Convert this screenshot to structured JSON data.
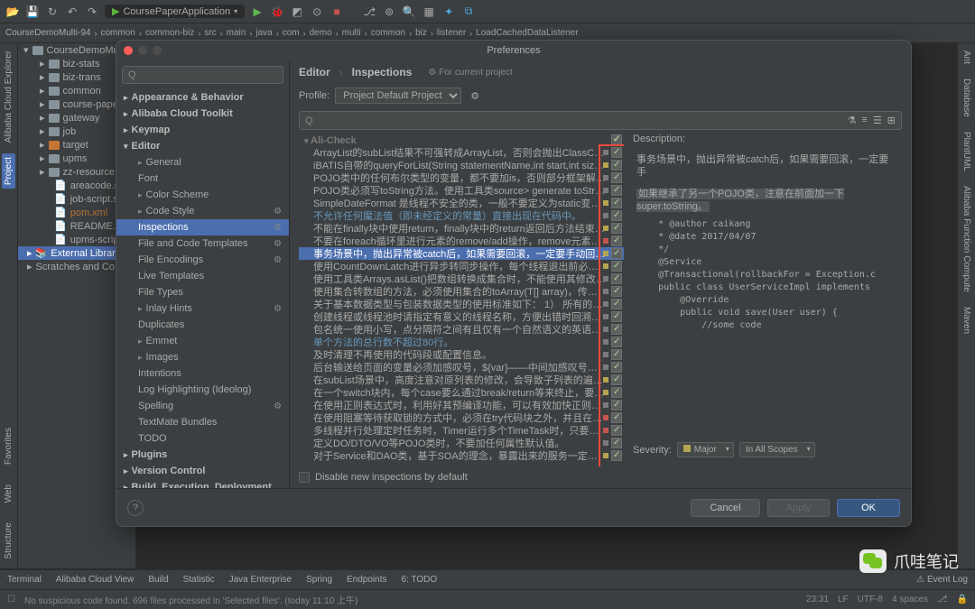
{
  "toolbar": {
    "run_config": "CoursePaperApplication"
  },
  "breadcrumb": [
    "CourseDemoMulti-94",
    "common",
    "common-biz",
    "src",
    "main",
    "java",
    "com",
    "demo",
    "multi",
    "common",
    "biz",
    "listener",
    "LoadCachedDataListener"
  ],
  "project_tree": {
    "root": "CourseDemoMu",
    "items": [
      {
        "label": "biz-stats",
        "folder": true
      },
      {
        "label": "biz-trans",
        "folder": true
      },
      {
        "label": "common",
        "folder": true
      },
      {
        "label": "course-pape",
        "folder": true
      },
      {
        "label": "gateway",
        "folder": true
      },
      {
        "label": "job",
        "folder": true
      },
      {
        "label": "target",
        "folder": true,
        "orange": true
      },
      {
        "label": "upms",
        "folder": true
      },
      {
        "label": "zz-resource",
        "folder": true
      },
      {
        "label": "areacode.sql",
        "file": true
      },
      {
        "label": "job-script.sc",
        "file": true
      },
      {
        "label": "pom.xml",
        "file": true,
        "xml": true
      },
      {
        "label": "README.md",
        "file": true
      },
      {
        "label": "upms-script.",
        "file": true
      }
    ],
    "ext_lib": "External Librarie",
    "scratches": "Scratches and Co"
  },
  "left_tabs": [
    "Alibaba Cloud Explorer",
    "Project"
  ],
  "right_tabs": [
    "Ant",
    "Database",
    "PlantUML",
    "Alibaba Function Compute",
    "Maven"
  ],
  "dialog": {
    "title": "Preferences",
    "search_placeholder": "Q",
    "categories": [
      {
        "label": "Appearance & Behavior",
        "group": true
      },
      {
        "label": "Alibaba Cloud Toolkit",
        "group": true
      },
      {
        "label": "Keymap",
        "group": true,
        "flat": true
      },
      {
        "label": "Editor",
        "group": true,
        "expanded": true
      },
      {
        "label": "General",
        "sub": true,
        "hasgear": false,
        "arrow": true
      },
      {
        "label": "Font",
        "sub": true
      },
      {
        "label": "Color Scheme",
        "sub": true,
        "arrow": true
      },
      {
        "label": "Code Style",
        "sub": true,
        "hasgear": true,
        "arrow": true
      },
      {
        "label": "Inspections",
        "sub": true,
        "hasgear": true,
        "sel": true
      },
      {
        "label": "File and Code Templates",
        "sub": true,
        "hasgear": true
      },
      {
        "label": "File Encodings",
        "sub": true,
        "hasgear": true
      },
      {
        "label": "Live Templates",
        "sub": true
      },
      {
        "label": "File Types",
        "sub": true
      },
      {
        "label": "Inlay Hints",
        "sub": true,
        "hasgear": true,
        "arrow": true
      },
      {
        "label": "Duplicates",
        "sub": true
      },
      {
        "label": "Emmet",
        "sub": true,
        "arrow": true
      },
      {
        "label": "Images",
        "sub": true,
        "arrow": true
      },
      {
        "label": "Intentions",
        "sub": true
      },
      {
        "label": "Log Highlighting (Ideolog)",
        "sub": true
      },
      {
        "label": "Spelling",
        "sub": true,
        "hasgear": true
      },
      {
        "label": "TextMate Bundles",
        "sub": true
      },
      {
        "label": "TODO",
        "sub": true
      },
      {
        "label": "Plugins",
        "group": true,
        "flat": true
      },
      {
        "label": "Version Control",
        "group": true
      },
      {
        "label": "Build, Execution, Deployment",
        "group": true
      },
      {
        "label": "Languages & Frameworks",
        "group": true
      }
    ],
    "crumb_a": "Editor",
    "crumb_b": "Inspections",
    "scope": "For current project",
    "profile_label": "Profile:",
    "profile_value": "Project Default  Project",
    "group_header": "Ali-Check",
    "items": [
      {
        "t": "ArrayList的subList结果不可强转成ArrayList，否则会抛出ClassCastExc",
        "sev": "gray",
        "ck": true
      },
      {
        "t": "iBATIS自带的queryForList(String statementName,int start,int size)不",
        "sev": "yellow",
        "ck": true
      },
      {
        "t": "POJO类中的任何布尔类型的变量，都不要加is，否则部分框架解析会引起",
        "sev": "gray",
        "ck": true
      },
      {
        "t": "POJO类必须写toString方法。使用工具类source> generate toString时，",
        "sev": "gray",
        "ck": true
      },
      {
        "t": "SimpleDateFormat 是线程不安全的类，一般不要定义为static变量，如果",
        "sev": "yellow",
        "ck": true
      },
      {
        "t": "不允许任何魔法值（即未经定义的常量）直接出现在代码中。",
        "sev": "gray",
        "ck": true,
        "blue": true
      },
      {
        "t": "不能在finally块中使用return，finally块中的return返回后方法结束执行，",
        "sev": "yellow",
        "ck": true
      },
      {
        "t": "不要在foreach循环里进行元素的remove/add操作，remove元素请使用It",
        "sev": "red",
        "ck": true
      },
      {
        "t": "事务场景中，抛出异常被catch后，如果需要回滚，一定要手动回滚事务。",
        "sev": "yellow",
        "ck": true,
        "sel": true
      },
      {
        "t": "使用CountDownLatch进行异步转同步操作，每个线程退出前必须调用co",
        "sev": "yellow",
        "ck": true
      },
      {
        "t": "使用工具类Arrays.asList()把数组转换成集合时，不能使用其修改集合相关",
        "sev": "gray",
        "ck": true
      },
      {
        "t": "使用集合转数组的方法，必须使用集合的toArray(T[] array)，传入的是类",
        "sev": "gray",
        "ck": true
      },
      {
        "t": "关于基本数据类型与包装数据类型的使用标准如下：    1） 所有的POJO类",
        "sev": "gray",
        "ck": true
      },
      {
        "t": "创建线程或线程池时请指定有意义的线程名称，方便出错时回溯。创建线",
        "sev": "gray",
        "ck": true
      },
      {
        "t": "包名统一使用小写，点分隔符之间有且仅有一个自然语义的英语单词。包名",
        "sev": "gray",
        "ck": true
      },
      {
        "t": "单个方法的总行数不超过80行。",
        "sev": "gray",
        "ck": true,
        "blue": true
      },
      {
        "t": "及时清理不再使用的代码段或配置信息。",
        "sev": "gray",
        "ck": true
      },
      {
        "t": "后台输送给页面的变量必须加感叹号，${var}——中间加感叹号！。",
        "sev": "gray",
        "ck": true
      },
      {
        "t": "在subList场景中，高度注意对原列表的修改，会导致子列表的遍历、增加",
        "sev": "yellow",
        "ck": true
      },
      {
        "t": "在一个switch块内，每个case要么通过break/return等来终止，要么注释",
        "sev": "yellow",
        "ck": true
      },
      {
        "t": "在使用正则表达式时，利用好其预编译功能，可以有效加快正则匹配速度。",
        "sev": "gray",
        "ck": true
      },
      {
        "t": "在使用阻塞等待获取锁的方式中，必须在try代码块之外，并且在加锁方法",
        "sev": "red",
        "ck": true
      },
      {
        "t": "多线程并行处理定时任务时，Timer运行多个TimeTask时，只要其中之一抛",
        "sev": "red",
        "ck": true
      },
      {
        "t": "定义DO/DTO/VO等POJO类时，不要加任何属性默认值。",
        "sev": "gray",
        "ck": true
      },
      {
        "t": "对于Service和DAO类，基于SOA的理念，暴露出来的服务一定是接口，内",
        "sev": "yellow",
        "ck": true
      }
    ],
    "disable_label": "Disable new inspections by default",
    "desc_title": "Description:",
    "desc_main": "事务场景中，抛出异常被catch后，如果需要回滚，一定要手",
    "desc_hl": "如果继承了另一个POJO类，注意在前面加一下super.toString。",
    "desc_code": "    * @author caikang\n    * @date 2017/04/07\n    */\n    @Service\n    @Transactional(rollbackFor = Exception.c\n    public class UserServiceImpl implements\n        @Override\n        public void save(User user) {\n            //some code",
    "sev_label": "Severity:",
    "sev_value": "Major",
    "scope_value": "In All Scopes",
    "btn_cancel": "Cancel",
    "btn_apply": "Apply",
    "btn_ok": "OK"
  },
  "bottom_tabs": [
    "Terminal",
    "Alibaba Cloud View",
    "Build",
    "Statistic",
    "Java Enterprise",
    "Spring",
    "Endpoints",
    "6: TODO"
  ],
  "bottom_right": "Event Log",
  "status": {
    "msg": "No suspicious code found. 696 files processed in 'Selected files'. (today 11:10 上午)",
    "pos": "23:31",
    "enc": "LF",
    "cs": "UTF-8",
    "ind": "4 spaces"
  },
  "watermark": "爪哇笔记"
}
